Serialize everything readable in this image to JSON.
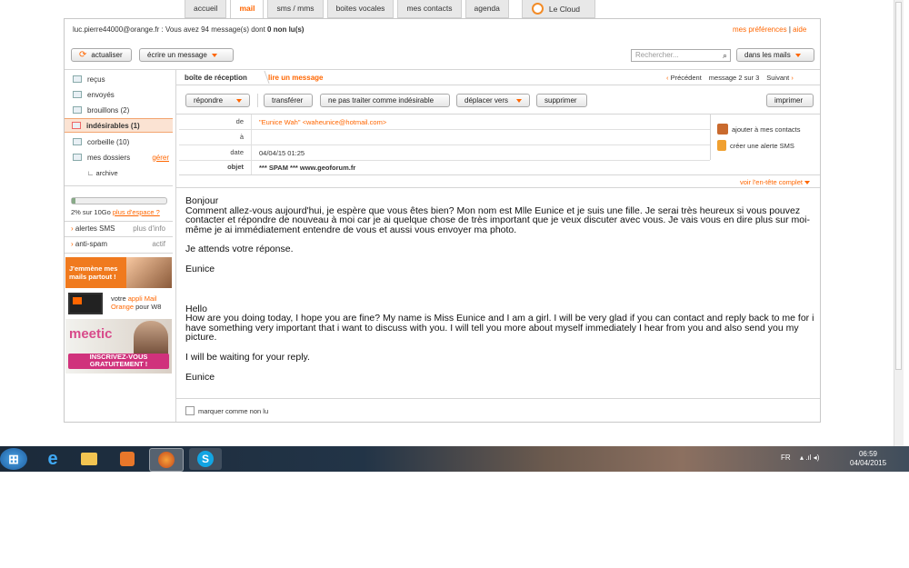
{
  "tabs": {
    "accueil": "accueil",
    "mail": "mail",
    "sms": "sms / mms",
    "voice": "boites vocales",
    "contacts": "mes contacts",
    "agenda": "agenda",
    "cloud": "Le Cloud"
  },
  "account": {
    "summary": "luc.pierre44000@orange.fr : Vous avez 94 message(s) dont",
    "unread": "0 non lu(s)",
    "prefs": "mes préférences",
    "help": "aide"
  },
  "toolbar": {
    "refresh": "actualiser",
    "write": "écrire un message",
    "search_placeholder": "Rechercher...",
    "scope": "dans les mails"
  },
  "folders": {
    "recus": "reçus",
    "envoyes": "envoyés",
    "brouillons": "brouillons (2)",
    "indesirables": "indésirables (1)",
    "corbeille": "corbeille (10)",
    "mes_dossiers": "mes dossiers",
    "gerer": "gérer",
    "archive": "archive"
  },
  "storage": {
    "text": "2% sur 10Go",
    "link": "plus d'espace ?"
  },
  "side_links": {
    "sms": "alertes SMS",
    "sms_info": "plus d'info",
    "spam": "anti-spam",
    "spam_state": "actif"
  },
  "ads": {
    "ad1": "J'emmène mes mails partout !",
    "ad2_a": "votre ",
    "ad2_b": "appli Mail Orange",
    "ad2_c": " pour W8",
    "ad3_logo": "meetic",
    "ad3_btn": "INSCRIVEZ-VOUS GRATUITEMENT !"
  },
  "breadcrumb": {
    "inbox": "boîte de réception",
    "current": "lire un message",
    "prev": "Précédent",
    "pos": "message  2  sur  3",
    "next": "Suivant"
  },
  "actions": {
    "reply": "répondre",
    "forward": "transférer",
    "notspam": "ne pas traiter comme indésirable",
    "move": "déplacer vers",
    "delete": "supprimer",
    "print": "imprimer"
  },
  "header": {
    "de_label": "de",
    "de_value": "\"Eunice Wah\" <waheunice@hotmail.com>",
    "a_label": "à",
    "a_value": "",
    "date_label": "date",
    "date_value": "04/04/15 01:25",
    "objet_label": "objet",
    "objet_value": "*** SPAM *** www.geoforum.fr",
    "add_contact": "ajouter à mes contacts",
    "sms_alert": "créer une alerte SMS",
    "full_header": "voir l'en-tête complet"
  },
  "message": {
    "p1a": "Bonjour",
    "p1b": "Comment allez-vous aujourd'hui, je espère que vous êtes bien? Mon nom est Mlle Eunice et je suis une fille. Je serai très heureux si vous pouvez contacter et répondre de nouveau à moi car je ai quelque chose de très important que je veux discuter avec vous. Je vais vous en dire plus sur moi-même je ai immédiatement entendre de vous et aussi vous envoyer ma photo.",
    "p2": "Je attends votre réponse.",
    "p3": "Eunice",
    "p4a": "Hello",
    "p4b": "How are you doing today, I hope you are fine? My name is Miss Eunice and I am a girl. I will be very glad if you can contact and reply back to me for i have something very important that i want to discuss with you. I will tell you more about myself immediately I hear from you and also send you my picture.",
    "p5": "I will be waiting for your reply.",
    "p6": "Eunice"
  },
  "footer": {
    "mark_unread": "marquer comme non lu"
  },
  "taskbar": {
    "lang": "FR",
    "time": "06:59",
    "date": "04/04/2015"
  },
  "colors": {
    "accent": "#ff6600"
  }
}
